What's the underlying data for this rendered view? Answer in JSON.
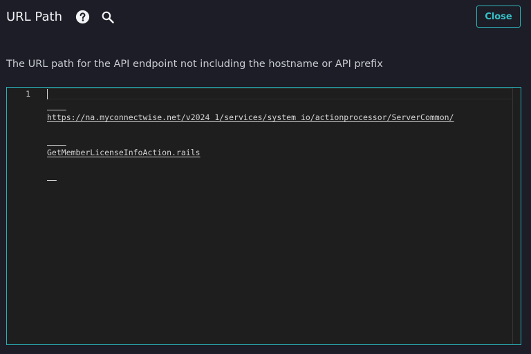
{
  "header": {
    "title": "URL Path",
    "icons": {
      "help": "help-circle-icon",
      "search": "search-icon"
    },
    "close_label": "Close"
  },
  "description": "The URL path for the API endpoint not including the hostname or API prefix",
  "editor": {
    "line_number": "1",
    "code_lines": [
      "https://na.myconnectwise.net/v2024_1/services/system_io/actionprocessor/ServerCommon/",
      "GetMemberLicenseInfoAction.rails"
    ]
  },
  "colors": {
    "background": "#1c1d26",
    "accent": "#2fb7bf",
    "editor_background": "#1e1e1e"
  }
}
